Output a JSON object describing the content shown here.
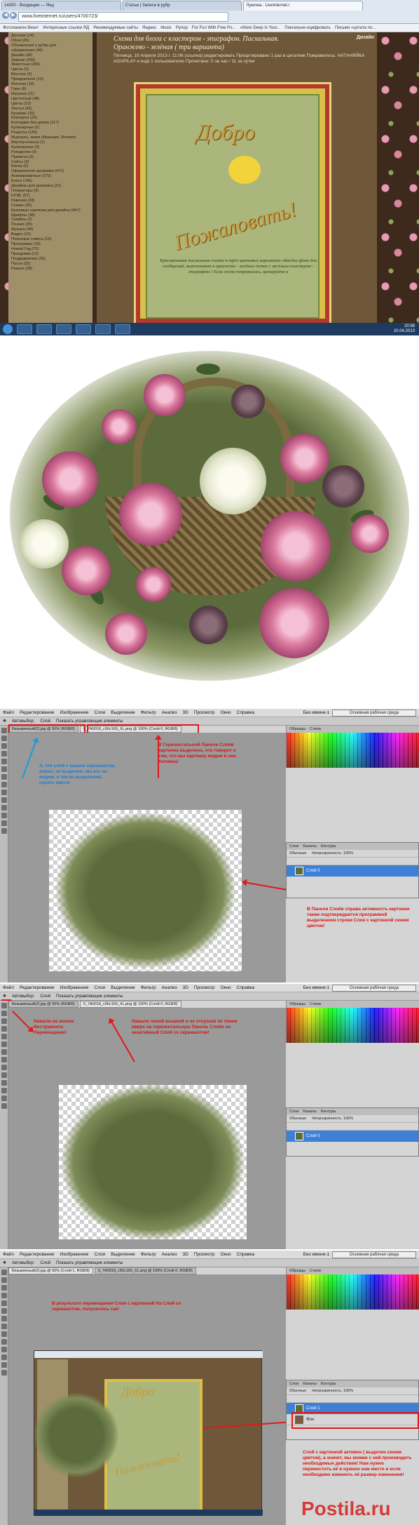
{
  "browser": {
    "tabs": [
      "14300 - Входящие — Янд",
      "Статьи | Записи в рубр",
      "Лукочка : LiveInternet.r"
    ],
    "url": "www.liveinternet.ru/users/4700723/",
    "bookmarks": [
      "Фотопанели Bкoнт",
      "Интересные ссылки ЯД",
      "Рекомендуемые сайты",
      "Яндекс",
      "Music",
      "Рупор",
      "For Fun With Free Po...",
      "«More Deep Is Your...",
      "Пиксельно-оцифровать",
      "Письмо «цитата по..."
    ],
    "sidebar_items": [
      "Детские (14)",
      "Обои (26)",
      "Объявления о рубки для",
      "оформления (44)",
      "Дизайн (46)",
      "Зимние (396)",
      "Животные (386)",
      "Цветы (3)",
      "Вкусное (2)",
      "Праздничное (13)",
      "Фэнтези (18)",
      "Горы (8)",
      "Игрушки (11)",
      "Цветочный (48)",
      "Цветы (13)",
      "Листья (65)",
      "Кружево (35)",
      "Клипарты (23)",
      "Колледжи без домов (117)",
      "Кулинарные (5)",
      "Рецепты (129)",
      "Журналы, книги (Франция, Япония)",
      "Мастер-классы (1)",
      "Кулинарные (2)",
      "Рукоделие (4)",
      "Приметы (3)",
      "Сайты (3)",
      "Бисер (5)",
      "Оформление дневника (472)",
      "Анимированные (275)",
      "Блоги (146)",
      "Дизайны для дневника (21)",
      "Генераторы (5)",
      "HTML (57)",
      "Рамочки (28)",
      "Схемы (35)",
      "Красивые картинки для дизайна (447)",
      "Шрифты (38)",
      "Смайлы (2)",
      "Поэзия (35)",
      "Музыка (49)",
      "Видео (10)",
      "Полезные советы (16)",
      "Программы (18)",
      "Новый Год (70)",
      "Праздники (12)",
      "Поздравления (25)",
      "Пасха (23)",
      "Разное (28)"
    ],
    "post_title": "Схема для блога с кластером - эпиграфом. Пасхальная.",
    "post_subtitle": "Оранжево - зелёная ( три варианта)",
    "post_author": "Дизайн",
    "post_meta": "Пятница, 19 Апреля 2013 г. 11:06 (ссылка) редактировать Процитировано 1 раз в цитатник Понравилось: НАТАНЯЙКА AGAPILAY и ещё 1 пользователю Прочитано: 0 за час / 11 за сутки",
    "greeting_top": "Добро",
    "greeting_bottom": "Пожаловать!",
    "post_text": "Красивенькая пасхальная схемка в трёх цветовых вариантах обводки фона для сообщений, выполненная в оранжево - зелёных тонах с весёлым кластером - эпиграфом ! Если схема понравилась, цитируйте в",
    "clock_time": "20:58",
    "clock_date": "20.04.2013"
  },
  "ps1": {
    "menu": [
      "Файл",
      "Редактирование",
      "Изображение",
      "Слои",
      "Выделение",
      "Фильтр",
      "Анализ",
      "3D",
      "Просмотр",
      "Окно",
      "Справка"
    ],
    "workspace": "Без имени-1",
    "workspace_btn": "Основная рабочая среда",
    "opts_auto": "Автовыбор:",
    "opts_group": "Слой",
    "opts_show": "Показать управляющие элементы",
    "doc_tab1": "Безымянный(2).jpg @ 50% (RGB/8)",
    "doc_tab2": "0_7A0018_c56c169_XL.png @ 100% (Слой 0, RGB/8)",
    "anno_left": "А, это слой с нашим скриншотом, верно, он выделен, мы его не видим, и после выделения, серого цвета!",
    "anno_top": "В Горизонтальной Панели Слоёв картинка выделена, что говорит о том, что мы картинку видим и она Активна!",
    "anno_right": "В Панели Слоёв справа активность картинки также подтверждается программой выделением строки Слоя с картинкой синим цветом!",
    "swatch_tabs": [
      "Образцы",
      "Стили"
    ],
    "layer_tabs": [
      "Слои",
      "Каналы",
      "Контуры"
    ],
    "blend": "Обычные",
    "opacity": "Непрозрачность: 100%",
    "layer_name": "Слой 0"
  },
  "ps2": {
    "doc_tab": "0_7A0018_c56c169_XL.png @ 100% (Слой 0, RGB/8)",
    "anno_left": "Нажали на значок Инструмента Перемещение!",
    "anno_top": "Нажали левой мышкой и не отпуская её тянем вверх на горизонтальную Панель Слоёв на неактивный Слой со скриншотом!",
    "layer_name": "Слой 0"
  },
  "ps3": {
    "doc_tab1": "Безымянный(2).jpg @ 50% (Слой 1, RGB/8)",
    "doc_tab2": "0_7A0018_c56c169_XL.png @ 100% (Слой 0, RGB/8)",
    "anno_top": "В результате перемещения Слоя с картинкой На Слой со скриншотом, получилось так!",
    "anno_right": "Слой с картинкой активен ( выделен синим цветом), а значит, мы можем с ней производить необходимые действия! Нам нужно переместить её в нужное нам место и если необходимо изменить её размер изменения!",
    "layer1": "Слой 1",
    "layer0": "Фон",
    "greeting_top": "Добро",
    "greeting_bottom": "Пожаловать!"
  },
  "watermark": "Postila.ru"
}
